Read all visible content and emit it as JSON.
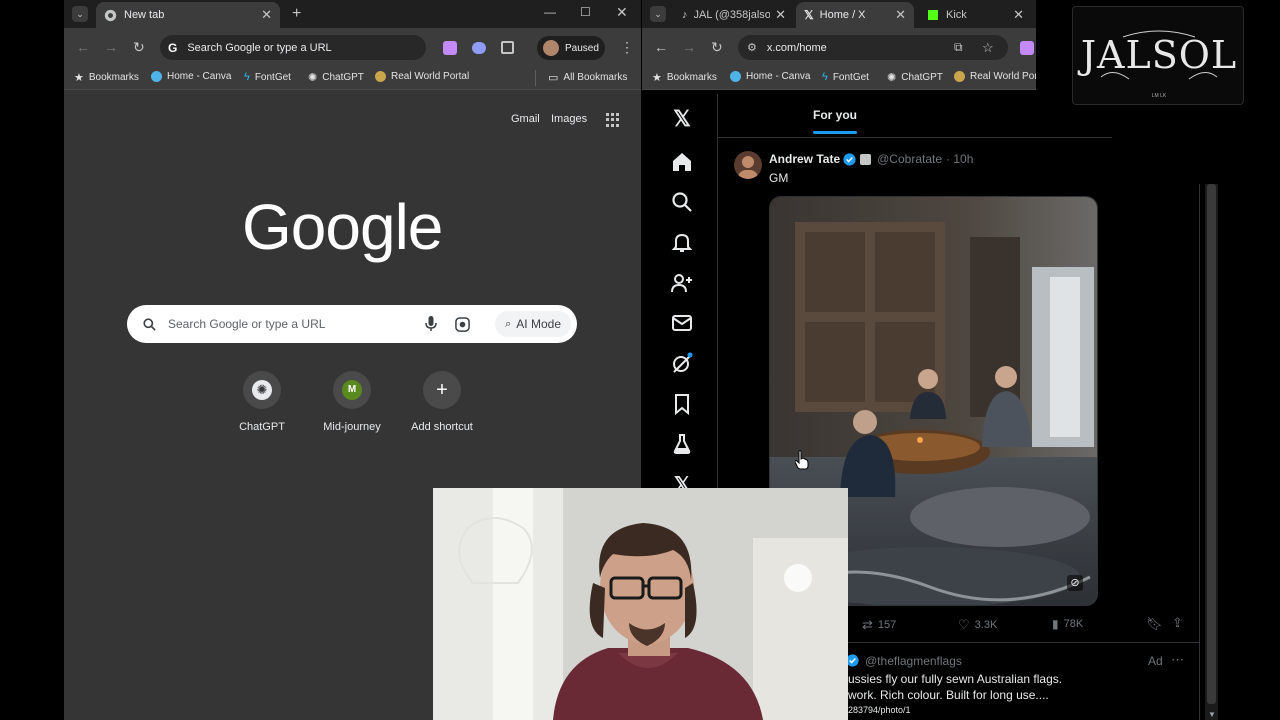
{
  "left_window": {
    "tab_title": "New tab",
    "new_tab_symbol": "+",
    "address_placeholder": "Search Google or type a URL",
    "profile_status": "Paused",
    "bookmarks": [
      "Bookmarks",
      "Home - Canva",
      "FontGet",
      "ChatGPT",
      "Real World Portal"
    ],
    "all_bookmarks": "All Bookmarks",
    "ntp": {
      "gmail": "Gmail",
      "images": "Images",
      "logo": "Google",
      "search_placeholder": "Search Google or type a URL",
      "ai_mode": "AI Mode",
      "shortcuts": [
        {
          "label": "ChatGPT",
          "letter": ""
        },
        {
          "label": "Mid-journey",
          "letter": "M"
        },
        {
          "label": "Add shortcut",
          "letter": "+"
        }
      ]
    }
  },
  "right_window": {
    "tabs": [
      {
        "title": "JAL (@358jalsol",
        "active": false
      },
      {
        "title": "Home / X",
        "active": true
      },
      {
        "title": "Kick",
        "active": false
      }
    ],
    "url": "x.com/home",
    "bookmarks": [
      "Bookmarks",
      "Home - Canva",
      "FontGet",
      "ChatGPT",
      "Real World Port"
    ]
  },
  "x_feed": {
    "tab_for_you": "For you",
    "post": {
      "author": "Andrew Tate",
      "handle": "@Cobratate",
      "time": "· 10h",
      "text": "GM",
      "retweets": "157",
      "likes": "3.3K",
      "views": "78K"
    },
    "ad": {
      "handle": "@theflagmenflags",
      "label": "Ad",
      "line1": "ussies fly our fully sewn Australian flags.",
      "line2": "work. Rich colour. Built for long use....",
      "link": "283794/photo/1"
    }
  },
  "overlay_logo": {
    "text": "JALSOL",
    "sub": "LM LK"
  },
  "colors": {
    "x_blue": "#1d9bf0",
    "chrome_dark": "#1f1f1f",
    "chrome_toolbar": "#3c3c3c",
    "ntp_bg": "#353535"
  }
}
